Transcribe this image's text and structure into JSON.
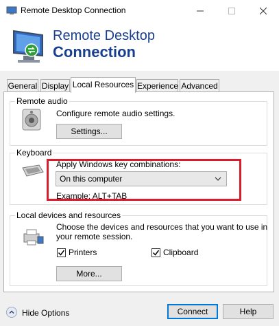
{
  "window": {
    "title": "Remote Desktop Connection",
    "controls": {
      "minimize": "—",
      "maximize": "☐",
      "close": "✕"
    }
  },
  "header": {
    "line1": "Remote Desktop",
    "line2": "Connection"
  },
  "tabs": [
    {
      "label": "General",
      "active": false
    },
    {
      "label": "Display",
      "active": false
    },
    {
      "label": "Local Resources",
      "active": true
    },
    {
      "label": "Experience",
      "active": false
    },
    {
      "label": "Advanced",
      "active": false
    }
  ],
  "remote_audio": {
    "title": "Remote audio",
    "description": "Configure remote audio settings.",
    "settings_button": "Settings..."
  },
  "keyboard": {
    "title": "Keyboard",
    "label": "Apply Windows key combinations:",
    "selected": "On this computer",
    "example": "Example: ALT+TAB"
  },
  "local_devices": {
    "title": "Local devices and resources",
    "description_line1": "Choose the devices and resources that you want to use in",
    "description_line2": "your remote session.",
    "printers": {
      "label": "Printers",
      "checked": true
    },
    "clipboard": {
      "label": "Clipboard",
      "checked": true
    },
    "more_button": "More..."
  },
  "footer": {
    "hide_options": "Hide Options",
    "connect": "Connect",
    "help": "Help"
  },
  "colors": {
    "header_text": "#1a3f8f",
    "highlight": "#d81e2c",
    "connect_border": "#0078d7"
  }
}
